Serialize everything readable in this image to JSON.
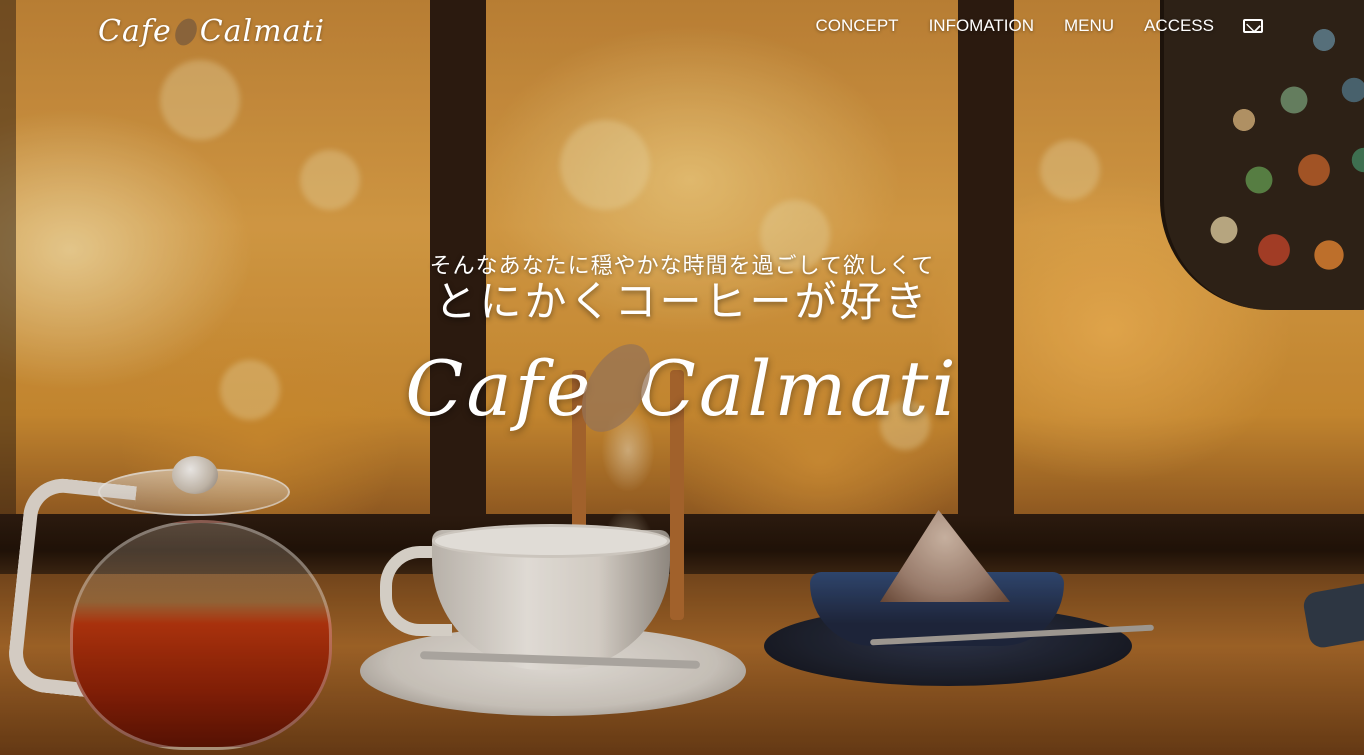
{
  "header": {
    "logo_text": "Cafe Calmati",
    "nav": [
      {
        "label": "CONCEPT"
      },
      {
        "label": "INFOMATION"
      },
      {
        "label": "MENU"
      },
      {
        "label": "ACCESS"
      }
    ],
    "mail_icon": "mail-icon"
  },
  "hero": {
    "tagline": "そんなあなたに穏やかな時間を過ごして欲しくて",
    "headline": "とにかくコーヒーが好き",
    "logo_left": "Cafe",
    "logo_right": "Calmati"
  },
  "colors": {
    "text": "#ffffff",
    "wood": "#2a1a10",
    "amber": "#e3a64a"
  }
}
